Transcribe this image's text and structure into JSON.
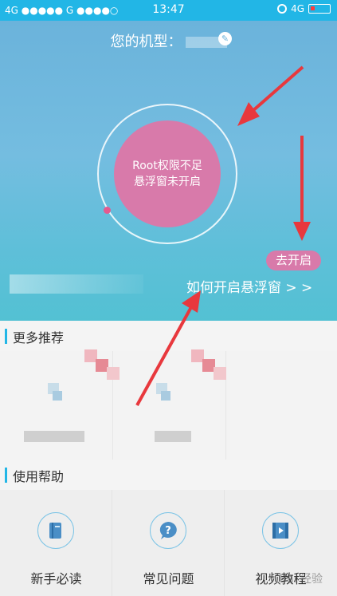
{
  "status_bar": {
    "left": "4G ●●●●● G ●●●●○",
    "time": "13:47",
    "network": "4G"
  },
  "hero": {
    "model_label": "您的机型：",
    "status_line1": "Root权限不足",
    "status_line2": "悬浮窗未开启",
    "go_open_label": "去开启",
    "howto_link": "如何开启悬浮窗 > >"
  },
  "sections": {
    "recommend_title": "更多推荐",
    "help_title": "使用帮助"
  },
  "help_items": [
    {
      "label": "新手必读",
      "icon": "book-icon"
    },
    {
      "label": "常见问题",
      "icon": "question-icon"
    },
    {
      "label": "视频教程",
      "icon": "video-icon"
    }
  ],
  "colors": {
    "accent": "#22b6e6",
    "status_pink": "#d87aaa",
    "arrow_red": "#e8383d"
  },
  "watermark": "Bai 经验"
}
